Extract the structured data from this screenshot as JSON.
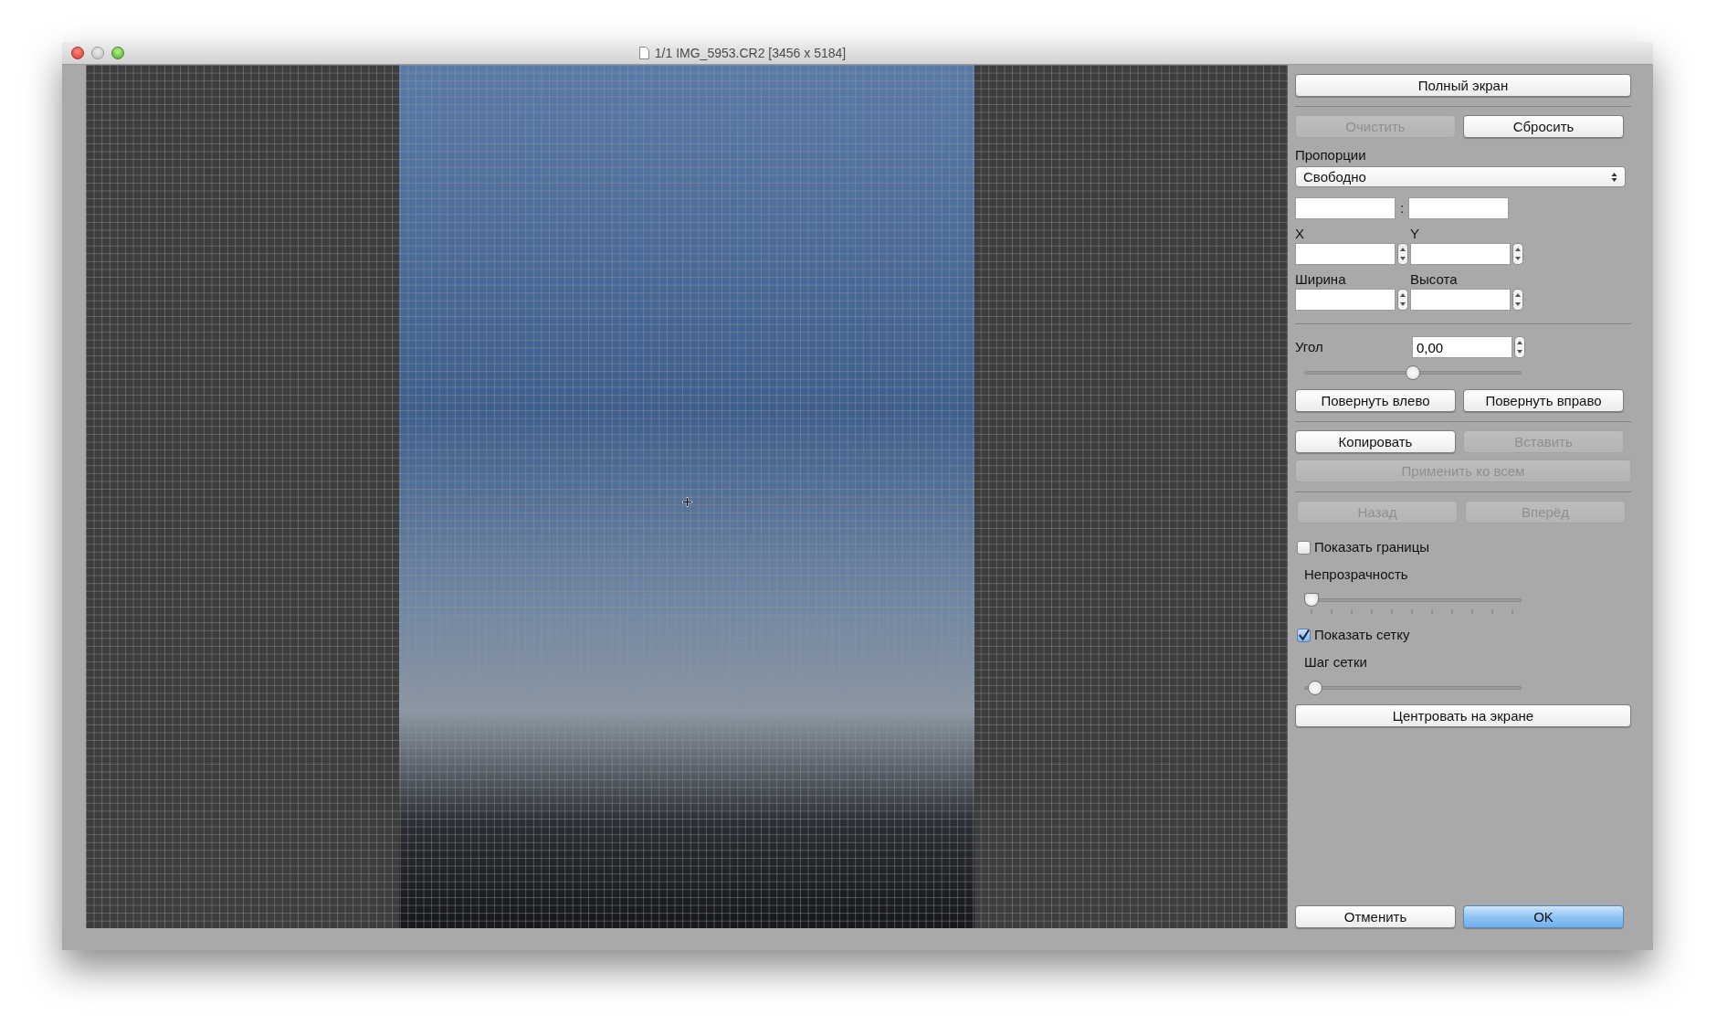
{
  "window": {
    "title": "1/1 IMG_5953.CR2 [3456 x 5184]"
  },
  "panel": {
    "fullscreen_button": {
      "label": "Полный экран",
      "disabled": false
    },
    "clear_button": {
      "label": "Очистить",
      "disabled": true
    },
    "reset_button": {
      "label": "Сбросить",
      "disabled": false
    },
    "proportions_label": "Пропорции",
    "proportions_select": {
      "value": "Свободно"
    },
    "ratio_separator": ":",
    "x_label": "X",
    "y_label": "Y",
    "width_label": "Ширина",
    "height_label": "Высота",
    "angle_label": "Угол",
    "angle_field": {
      "value": "0,00"
    },
    "angle_slider": {
      "kind": "plain",
      "level": 0.5
    },
    "rotate_left_button": {
      "label": "Повернуть влево",
      "disabled": false
    },
    "rotate_right_button": {
      "label": "Повернуть вправо",
      "disabled": false
    },
    "copy_button": {
      "label": "Копировать",
      "disabled": false
    },
    "paste_button": {
      "label": "Вставить",
      "disabled": true
    },
    "apply_all_button": {
      "label": "Применить ко всем",
      "disabled": true
    },
    "back_button": {
      "label": "Назад",
      "disabled": true
    },
    "forward_button": {
      "label": "Вперёд",
      "disabled": true
    },
    "show_borders": {
      "label": "Показать границы",
      "checked": false
    },
    "opacity_label": "Непрозрачность",
    "opacity_slider": {
      "kind": "ticked",
      "level": 0
    },
    "show_grid": {
      "label": "Показать сетку",
      "checked": true
    },
    "grid_step_label": "Шаг сетки",
    "grid_step_slider": {
      "kind": "plain",
      "level": 0.02
    },
    "center_button": {
      "label": "Центровать на экране",
      "disabled": false
    },
    "cancel_button": {
      "label": "Отменить",
      "disabled": false
    },
    "ok_button": {
      "label": "OK",
      "disabled": false,
      "default": true
    }
  }
}
